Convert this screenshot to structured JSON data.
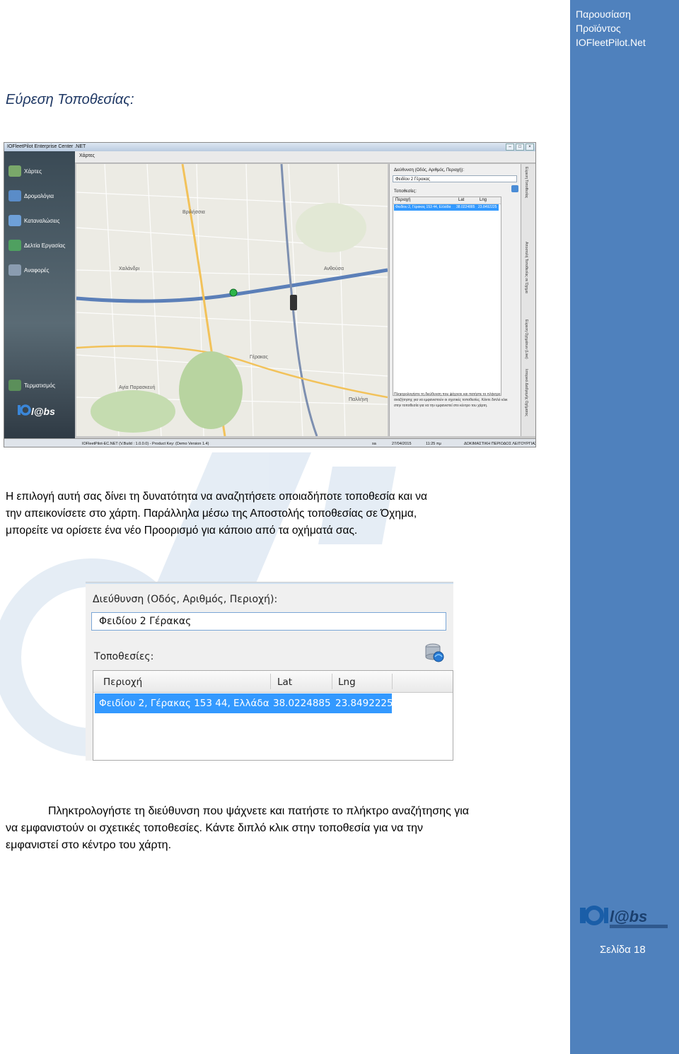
{
  "sidebar": {
    "title_lines": [
      "Παρουσίαση",
      "Προϊόντος",
      "IOFleetPilot.Net"
    ],
    "page_label": "Σελίδα 18",
    "accent_color": "#4f81bd"
  },
  "heading": "Εύρεση Τοποθεσίας:",
  "app": {
    "window_title": "IOFleetPilot Enterprise Center .NET",
    "tab_label": "Χάρτες",
    "nav": [
      "Χάρτες",
      "Δρομολόγια",
      "Καταναλώσεις",
      "Δελτία Εργασίας",
      "Αναφορές",
      "Τερματισμός"
    ],
    "panel": {
      "address_label": "Διεύθυνση (Οδός, Αριθμός, Περιοχή):",
      "address_value": "Φειδίου 2 Γέρακας",
      "locations_label": "Τοποθεσίες:",
      "columns": [
        "Περιοχή",
        "Lat",
        "Lng"
      ],
      "row": [
        "Φειδίου 2, Γέρακας 153 44, Ελλάδα",
        "38.0224885",
        "23.8492225"
      ],
      "help_text": "Πληκτρολογήστε τη διεύθυνση που ψάχνετε και πατήστε το πλήκτρο αναζήτησης για να εμφανιστούν οι σχετικές τοποθεσίες. Κάντε διπλό κλικ στην τοποθεσία για να την εμφανιστεί στο κέντρο του χάρτη."
    },
    "vertical_tabs": [
      "Εύρεση Τοποθεσίας",
      "Αποστολή Τοποθεσίας σε Όχημα",
      "Εύρεση Οχημάτων (Live)",
      "Ιστορικό Διαδρομής Οχήματος"
    ],
    "map_labels": [
      "Βριλήσσια",
      "Χαλάνδρι",
      "Ανθούσα",
      "Γέρακας",
      "Παλλήνη",
      "Αγία Παρασκευή"
    ],
    "status": {
      "version": "IOFleetPilot-EC.NET (V.Build : 1.0.0.0) - Product Key: (Demo Version 1.4)",
      "user": "sa",
      "date": "27/04/2015",
      "time": "11:25 πμ",
      "mode": "ΔΟΚΙΜΑΣΤΙΚΗ ΠΕΡΙΟΔΟΣ ΛΕΙΤΟΥΡΓΙΑΣ"
    }
  },
  "para1_lines": [
    "Η επιλογή αυτή σας δίνει τη δυνατότητα να αναζητήσετε οποιαδήποτε τοποθεσία και να",
    "την απεικονίσετε στο χάρτη. Παράλληλα μέσω της Αποστολής τοποθεσίας σε Όχημα,",
    "μπορείτε να ορίσετε ένα νέο Προορισμό για κάποιο από τα οχήματά σας."
  ],
  "zoom": {
    "address_label": "Διεύθυνση (Οδός, Αριθμός, Περιοχή):",
    "address_value": "Φειδίου 2 Γέρακας",
    "locations_label": "Τοποθεσίες:",
    "columns": [
      "Περιοχή",
      "Lat",
      "Lng"
    ],
    "row": [
      "Φειδίου 2, Γέρακας 153 44, Ελλάδα",
      "38.0224885",
      "23.8492225"
    ],
    "selection_color": "#3399ff"
  },
  "para2_lines": [
    "Πληκτρολογήστε τη διεύθυνση που ψάχνετε και πατήστε το πλήκτρο αναζήτησης για",
    "να εμφανιστούν οι σχετικές τοποθεσίες. Κάντε διπλό κλικ στην τοποθεσία για να την",
    "εμφανιστεί στο κέντρο του χάρτη."
  ]
}
